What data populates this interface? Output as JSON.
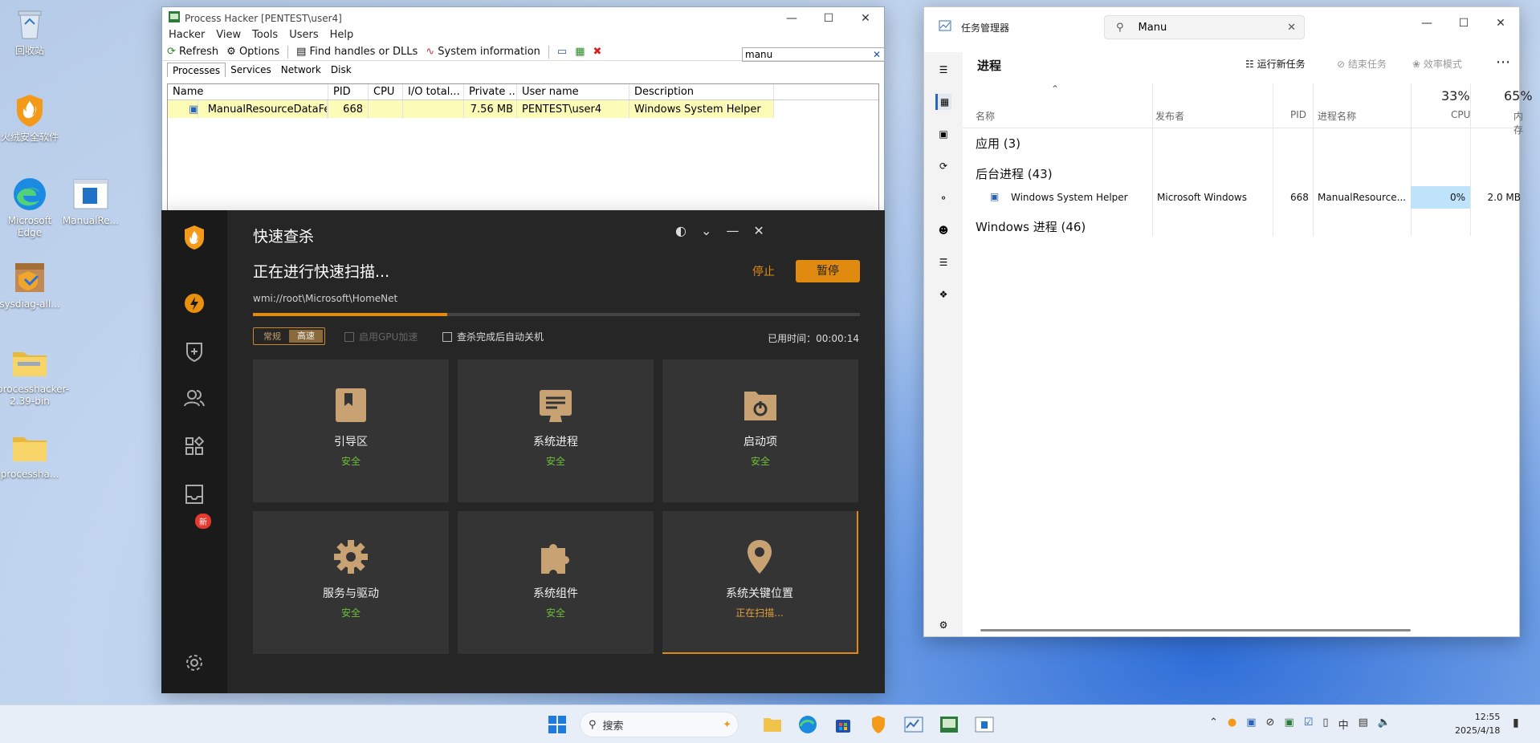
{
  "desktop": {
    "icons": [
      {
        "label": "回收站",
        "icon": "recycle-bin-icon"
      },
      {
        "label": "火绒安全软件",
        "icon": "huorong-shield-icon"
      },
      {
        "label": "Microsoft Edge",
        "icon": "edge-icon"
      },
      {
        "label": "ManualRe...",
        "icon": "app-window-icon"
      },
      {
        "label": "sysdiag-all...",
        "icon": "installer-icon"
      },
      {
        "label": "processhacker-2.39-bin",
        "icon": "folder-icon"
      },
      {
        "label": "processha...",
        "icon": "folder-icon"
      }
    ]
  },
  "process_hacker": {
    "title": "Process Hacker [PENTEST\\user4]",
    "menu": [
      "Hacker",
      "View",
      "Tools",
      "Users",
      "Help"
    ],
    "toolbar": {
      "refresh": "Refresh",
      "options": "Options",
      "find": "Find handles or DLLs",
      "sysinfo": "System information"
    },
    "search_value": "manu",
    "tabs": [
      "Processes",
      "Services",
      "Network",
      "Disk"
    ],
    "columns": [
      "Name",
      "PID",
      "CPU",
      "I/O total...",
      "Private ...",
      "User name",
      "Description"
    ],
    "rows": [
      {
        "name": "ManualResourceDataFet...",
        "pid": "668",
        "cpu": "",
        "io": "",
        "private": "7.56 MB",
        "user": "PENTEST\\user4",
        "desc": "Windows System Helper"
      }
    ]
  },
  "scanner": {
    "title": "快速查杀",
    "status": "正在进行快速扫描...",
    "path": "wmi://root\\Microsoft\\HomeNet",
    "progress_percent": 32,
    "stop_label": "停止",
    "pause_label": "暂停",
    "mode_normal": "常规",
    "mode_fast": "高速",
    "gpu_label": "启用GPU加速",
    "shutdown_label": "查杀完成后自动关机",
    "elapsed": "已用时间：00:00:14",
    "badge": "新",
    "tiles": [
      {
        "name": "引导区",
        "status": "安全",
        "icon": "bookmark-icon"
      },
      {
        "name": "系统进程",
        "status": "安全",
        "icon": "process-monitor-icon"
      },
      {
        "name": "启动项",
        "status": "安全",
        "icon": "power-folder-icon"
      },
      {
        "name": "服务与驱动",
        "status": "安全",
        "icon": "gear-icon"
      },
      {
        "name": "系统组件",
        "status": "安全",
        "icon": "puzzle-icon"
      },
      {
        "name": "系统关键位置",
        "status": "正在扫描...",
        "icon": "location-pin-icon"
      }
    ]
  },
  "task_manager": {
    "title": "任务管理器",
    "search_value": "Manu",
    "section": "进程",
    "run_task": "运行新任务",
    "end_task": "结束任务",
    "efficiency": "效率模式",
    "cols": {
      "name": "名称",
      "publisher": "发布者",
      "pid": "PID",
      "procname": "进程名称",
      "cpu_pct": "33%",
      "cpu": "CPU",
      "mem_pct": "65%",
      "mem": "内存"
    },
    "groups": {
      "apps": "应用 (3)",
      "bg": "后台进程 (43)",
      "win": "Windows 进程 (46)"
    },
    "row": {
      "name": "Windows System Helper",
      "publisher": "Microsoft Windows",
      "pid": "668",
      "procname": "ManualResource...",
      "cpu": "0%",
      "mem": "2.0 MB"
    }
  },
  "taskbar": {
    "search": "搜索",
    "ime": "中",
    "time": "12:55",
    "date": "2025/4/18"
  },
  "colors": {
    "accent_orange": "#e08a10",
    "safe_green": "#6fbf3a",
    "scanning": "#e3a13a"
  }
}
